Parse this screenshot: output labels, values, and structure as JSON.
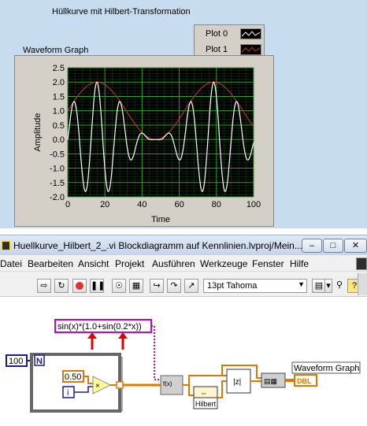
{
  "front_panel": {
    "title": "Hüllkurve mit Hilbert-Transformation",
    "legend": [
      {
        "label": "Plot 0",
        "color": "#ffffff"
      },
      {
        "label": "Plot 1",
        "color": "#e03030"
      }
    ],
    "graph": {
      "label": "Waveform Graph",
      "xlabel": "Time",
      "ylabel": "Amplitude"
    }
  },
  "chart_data": {
    "type": "line",
    "xlabel": "Time",
    "ylabel": "Amplitude",
    "xlim": [
      0,
      100
    ],
    "ylim": [
      -2.0,
      2.5
    ],
    "x_ticks": [
      0,
      20,
      40,
      60,
      80,
      100
    ],
    "y_ticks": [
      2.5,
      2.0,
      1.5,
      1.0,
      0.5,
      0.0,
      -0.5,
      -1.0,
      -1.5,
      -2.0
    ],
    "x_tick_labels": [
      "0",
      "20",
      "40",
      "60",
      "80",
      "100"
    ],
    "y_tick_labels": [
      "2.5",
      "2.0",
      "1.5",
      "1.0",
      "0.5",
      "0.0",
      "-0.5",
      "-1.0",
      "-1.5",
      "-2.0"
    ],
    "grid": true,
    "background": "#000000",
    "grid_color": "#1f7a1f",
    "series": [
      {
        "name": "Plot 0",
        "color": "#ffffff",
        "formula": "sin(0.5*i)*(1.0+sin(0.2*0.5*i))",
        "n": 100,
        "dx": 1
      },
      {
        "name": "Plot 1",
        "color": "#e03030",
        "formula": "|hilbert analytic envelope of Plot 0|",
        "n": 100,
        "dx": 1
      }
    ]
  },
  "block_diagram": {
    "title": "Huellkurve_Hilbert_2_.vi Blockdiagramm auf Kennlinien.lvproj/Mein...",
    "menu": [
      "Datei",
      "Bearbeiten",
      "Ansicht",
      "Projekt",
      "Ausführen",
      "Werkzeuge",
      "Fenster",
      "Hilfe"
    ],
    "font": "13pt Tahoma",
    "formula": "sin(x)*(1.0+sin(0.2*x))",
    "loop_count": "100",
    "loop_n": "N",
    "constant": "0.50",
    "iteration": "i",
    "hilbert_label": "Hilbert",
    "graph_label": "Waveform Graph",
    "dbl_label": "DBL"
  }
}
